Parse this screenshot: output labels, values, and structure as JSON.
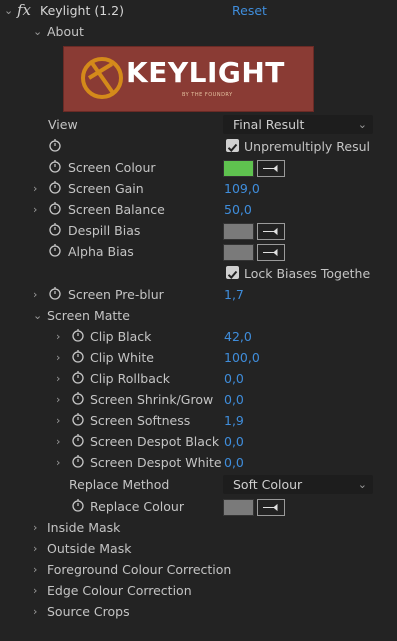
{
  "effect": {
    "title": "Keylight (1.2)",
    "reset": "Reset"
  },
  "about": {
    "label": "About"
  },
  "logo": {
    "name": "KEYLIGHT",
    "tagline": "BY THE FOUNDRY",
    "bg_color": "#8a3b34",
    "mark_color": "#d48a1a"
  },
  "view": {
    "label": "View",
    "value": "Final Result"
  },
  "unpremultiply": {
    "label": "Unpremultiply Resul",
    "checked": true
  },
  "screen_colour": {
    "label": "Screen Colour",
    "color": "#5fc24f"
  },
  "screen_gain": {
    "label": "Screen Gain",
    "value": "109,0"
  },
  "screen_balance": {
    "label": "Screen Balance",
    "value": "50,0"
  },
  "despill_bias": {
    "label": "Despill Bias",
    "color": "#7a7a7a"
  },
  "alpha_bias": {
    "label": "Alpha Bias",
    "color": "#7a7a7a"
  },
  "lock_biases": {
    "label": "Lock Biases Togethe",
    "checked": true
  },
  "screen_preblur": {
    "label": "Screen Pre-blur",
    "value": "1,7"
  },
  "screen_matte": {
    "label": "Screen Matte",
    "params": [
      {
        "label": "Clip Black",
        "value": "42,0"
      },
      {
        "label": "Clip White",
        "value": "100,0"
      },
      {
        "label": "Clip Rollback",
        "value": "0,0"
      },
      {
        "label": "Screen Shrink/Grow",
        "value": "0,0"
      },
      {
        "label": "Screen Softness",
        "value": "1,9"
      },
      {
        "label": "Screen Despot Black",
        "value": "0,0"
      },
      {
        "label": "Screen Despot White",
        "value": "0,0"
      }
    ],
    "replace_method": {
      "label": "Replace Method",
      "value": "Soft Colour"
    },
    "replace_colour": {
      "label": "Replace Colour",
      "color": "#7a7a7a"
    }
  },
  "groups": [
    "Inside Mask",
    "Outside Mask",
    "Foreground Colour Correction",
    "Edge Colour Correction",
    "Source Crops"
  ],
  "colors": {
    "accent_blue": "#3f8ddb",
    "panel_bg": "#232323",
    "text": "#c4c4c4"
  }
}
